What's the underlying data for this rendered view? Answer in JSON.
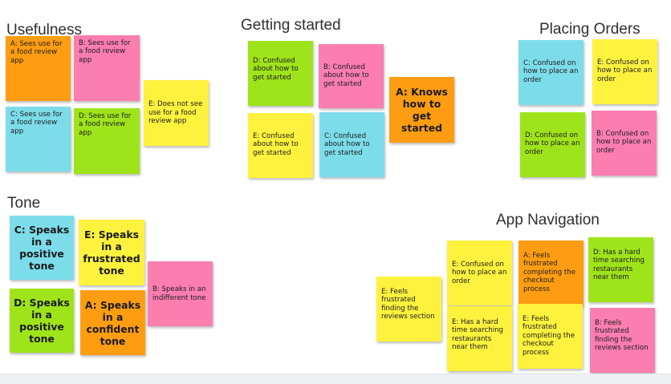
{
  "colors": {
    "orange": "#ff9d12",
    "pink": "#fb7eaf",
    "yellow": "#fef23e",
    "cyan": "#7ddcea",
    "green": "#9fe41a"
  },
  "headings": {
    "usefulness": "Usefulness",
    "getting_started": "Getting started",
    "placing_orders": "Placing Orders",
    "tone": "Tone",
    "app_navigation": "App Navigation"
  },
  "usefulness": [
    {
      "text": "A: Sees use for a food review app",
      "color": "orange"
    },
    {
      "text": "B: Sees use for a food review app",
      "color": "pink"
    },
    {
      "text": "C: Sees use for a food review app",
      "color": "cyan"
    },
    {
      "text": "D: Sees use for a food review app",
      "color": "green"
    },
    {
      "text": "E: Does not see use for a food review app",
      "color": "yellow"
    }
  ],
  "getting_started": [
    {
      "text": "D: Confused about how to get started",
      "color": "green"
    },
    {
      "text": "B: Confused about how to get started",
      "color": "pink"
    },
    {
      "text": "A: Knows how to get started",
      "color": "orange"
    },
    {
      "text": "E: Confused about how to get started",
      "color": "yellow"
    },
    {
      "text": "C: Confused about how to get started",
      "color": "cyan"
    }
  ],
  "placing_orders": [
    {
      "text": "C: Confused on how to place an order",
      "color": "cyan"
    },
    {
      "text": "E: Confused on how to place an order",
      "color": "yellow"
    },
    {
      "text": "D: Confused on how to place an order",
      "color": "green"
    },
    {
      "text": "B: Confused on how to place an order",
      "color": "pink"
    }
  ],
  "tone": [
    {
      "text": "C: Speaks in a positive tone",
      "color": "cyan"
    },
    {
      "text": "E: Speaks in a frustrated tone",
      "color": "yellow"
    },
    {
      "text": "B: Speaks in an indifferent tone",
      "color": "pink"
    },
    {
      "text": "D: Speaks in a positive tone",
      "color": "green"
    },
    {
      "text": "A: Speaks in a confident tone",
      "color": "orange"
    }
  ],
  "app_navigation": [
    {
      "text": "E: Feels frustrated finding the reviews section",
      "color": "yellow"
    },
    {
      "text": "E: Confused on how to place an order",
      "color": "yellow"
    },
    {
      "text": "A: Feels frustrated completing the checkout process",
      "color": "orange"
    },
    {
      "text": "D: Has a hard time searching restaurants near them",
      "color": "green"
    },
    {
      "text": "E: Has a hard time searching restaurants near them",
      "color": "yellow"
    },
    {
      "text": "E: Feels frustrated completing the checkout process",
      "color": "yellow"
    },
    {
      "text": "B: Feels frustrated finding the reviews section",
      "color": "pink"
    }
  ]
}
